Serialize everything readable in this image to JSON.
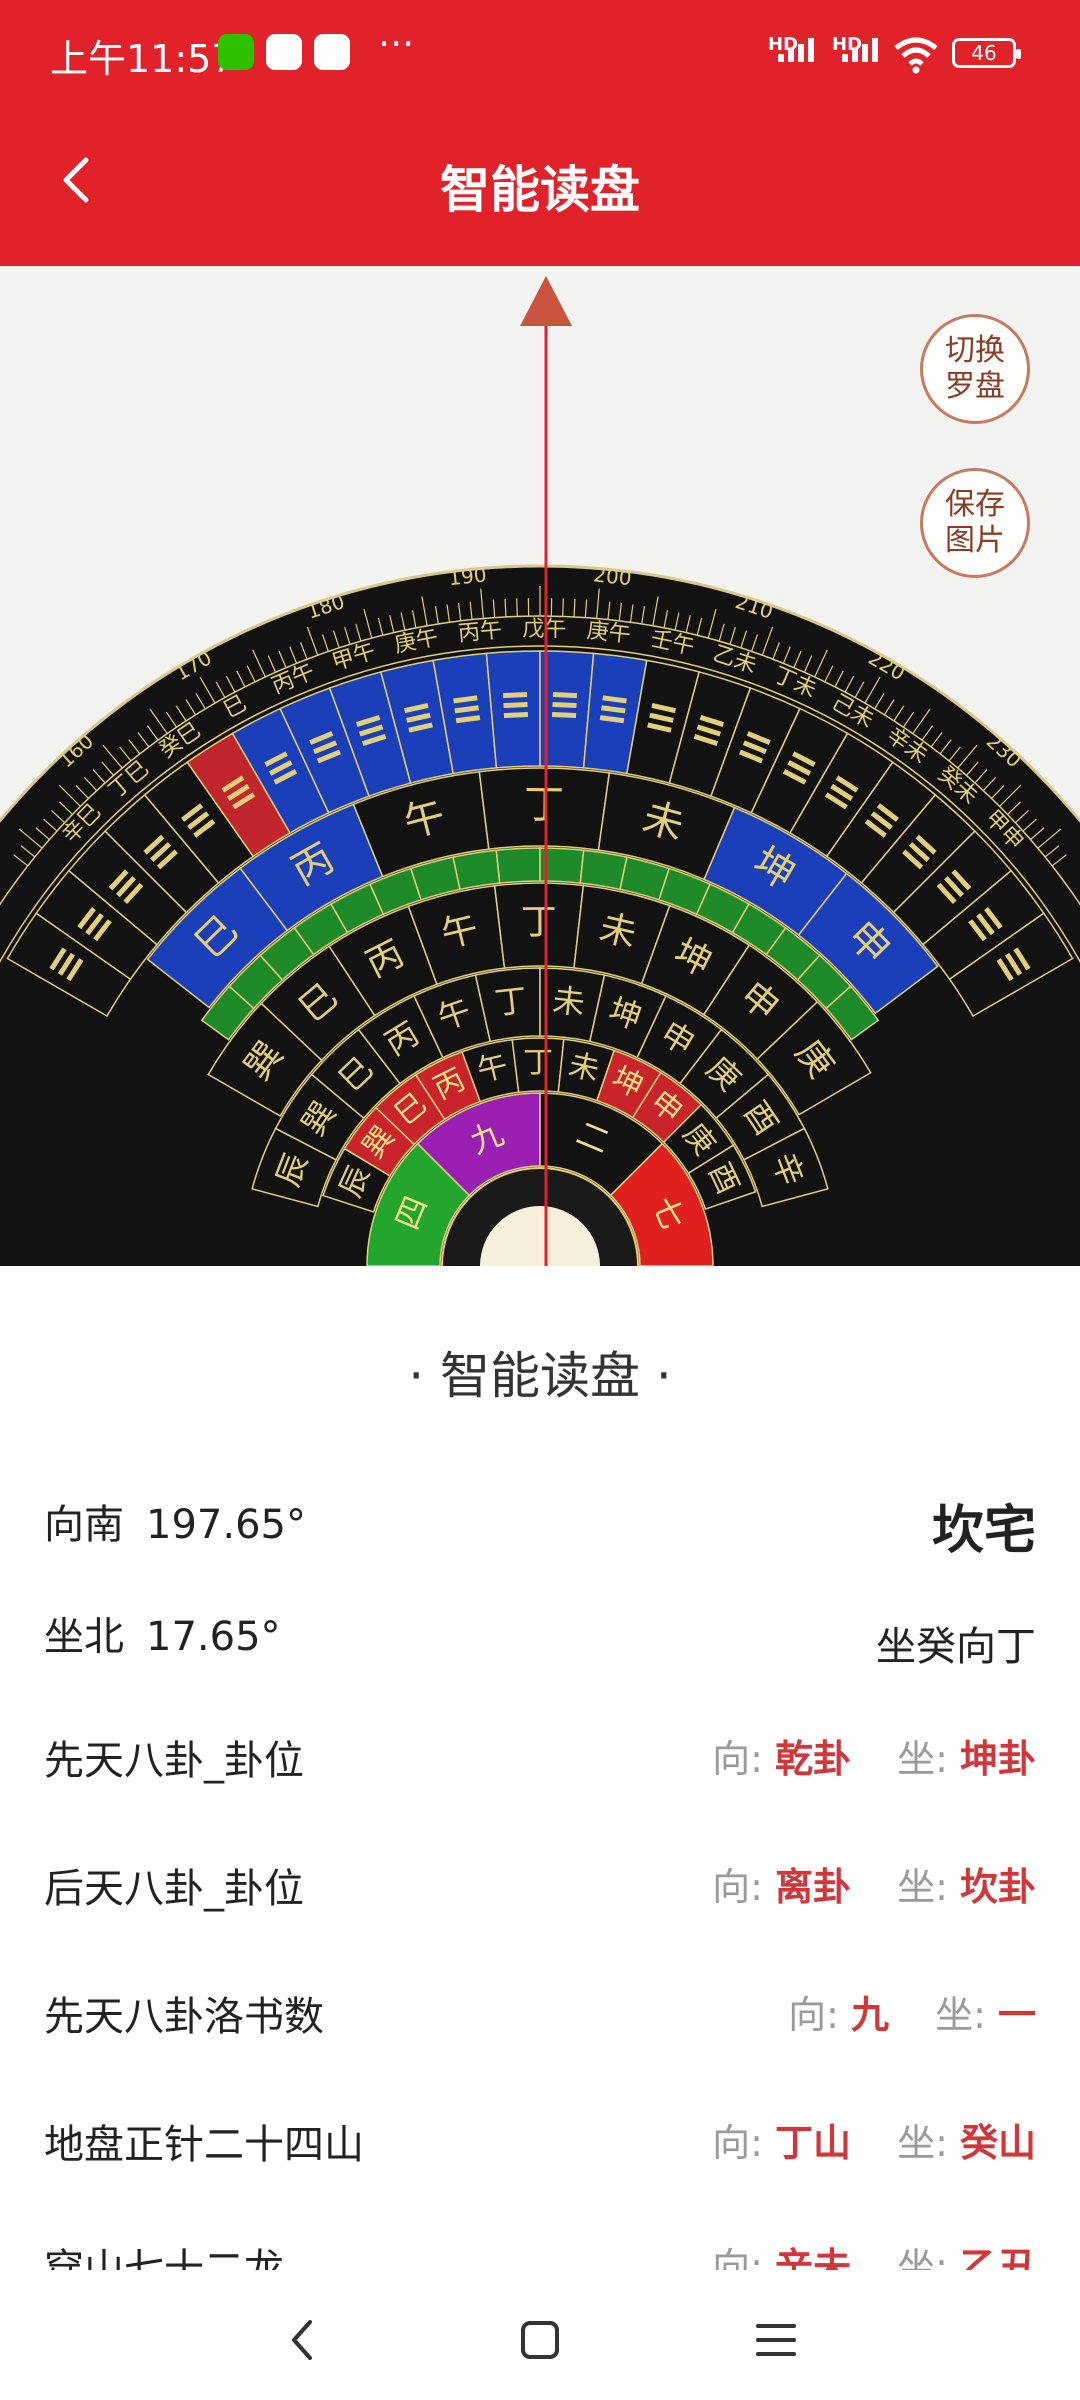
{
  "status_bar": {
    "time": "上午11:57",
    "signal_1": "HD",
    "signal_2": "HD",
    "battery": "46",
    "overflow": "···"
  },
  "header": {
    "title": "智能读盘"
  },
  "compass": {
    "switch_button": "切换罗盘",
    "save_button": "保存图片",
    "degree_labels": [
      "160",
      "170",
      "180",
      "190",
      "200",
      "210",
      "220",
      "230"
    ],
    "ring_text_outer": [
      "辛巳",
      "丁巳",
      "癸巳",
      "巳",
      "丙午",
      "甲午",
      "庚午",
      "丙午",
      "戊午",
      "庚午",
      "壬午",
      "乙未",
      "丁未",
      "己未",
      "辛未",
      "癸未",
      "甲申"
    ],
    "ring_mountains_a": [
      "巳",
      "丙",
      "午",
      "丁",
      "未",
      "坤",
      "申"
    ],
    "ring_mountains_b": [
      "巽",
      "巳",
      "丙",
      "午",
      "丁",
      "未",
      "坤",
      "申",
      "庚"
    ],
    "ring_mountains_c": [
      "辰",
      "巽",
      "巳",
      "丙",
      "午",
      "丁",
      "未",
      "坤",
      "申",
      "庚",
      "酉",
      "辛"
    ],
    "ring_inner": [
      "辰",
      "巽",
      "巳",
      "丙",
      "午",
      "丁",
      "未",
      "坤",
      "申",
      "庚",
      "酉"
    ],
    "nine_palace": [
      "四",
      "九",
      "二",
      "七"
    ]
  },
  "sheet": {
    "title": "· 智能读盘 ·",
    "rows": [
      {
        "label": "向南",
        "value": "197.65°",
        "right": "坎宅"
      },
      {
        "label": "坐北",
        "value": "17.65°",
        "right": "坐癸向丁"
      },
      {
        "label": "先天八卦_卦位",
        "xiang_k": "向:",
        "xiang_v": "乾卦",
        "zuo_k": "坐:",
        "zuo_v": "坤卦"
      },
      {
        "label": "后天八卦_卦位",
        "xiang_k": "向:",
        "xiang_v": "离卦",
        "zuo_k": "坐:",
        "zuo_v": "坎卦"
      },
      {
        "label": "先天八卦洛书数",
        "xiang_k": "向:",
        "xiang_v": "九",
        "zuo_k": "坐:",
        "zuo_v": "一"
      },
      {
        "label": "地盘正针二十四山",
        "xiang_k": "向:",
        "xiang_v": "丁山",
        "zuo_k": "坐:",
        "zuo_v": "癸山"
      },
      {
        "label": "穿山七十二龙",
        "xiang_k": "向:",
        "xiang_v": "辛未",
        "zuo_k": "坐:",
        "zuo_v": "乙丑"
      }
    ]
  },
  "colors": {
    "brand_red": "#e2222a",
    "value_red": "#d0363a",
    "compass_black": "#121212",
    "ring_blue": "#1a3fb8",
    "ring_green": "#1f8a2a",
    "gold": "#e3cf7a"
  }
}
